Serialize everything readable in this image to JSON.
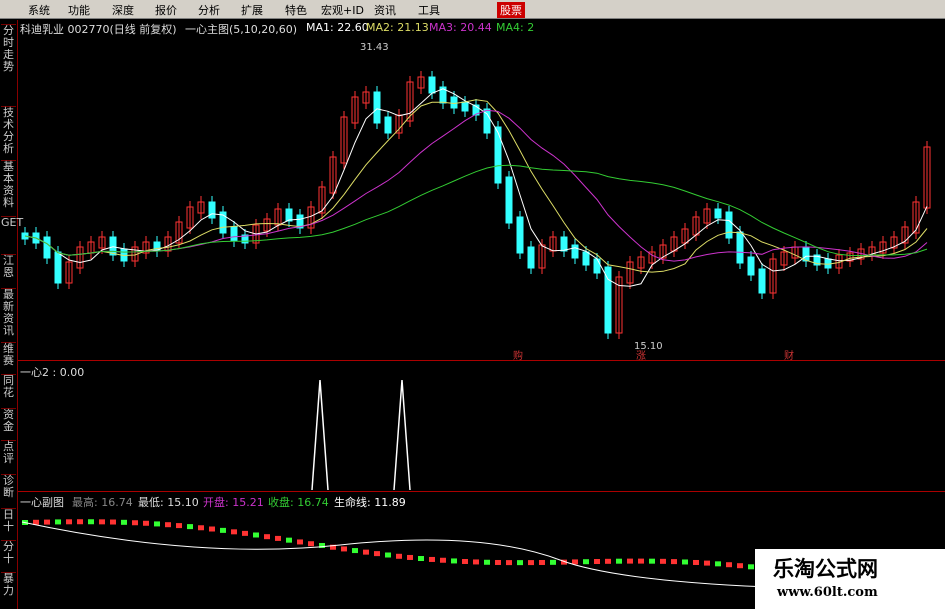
{
  "menu": [
    "系统",
    "功能",
    "深度",
    "报价",
    "分析",
    "扩展",
    "特色",
    "宏观+ID",
    "资讯",
    "工具"
  ],
  "menu_highlight": "股票",
  "sidebar": [
    "分时走势",
    "技术分析",
    "基本资料",
    "GET",
    "江恩",
    "最新资讯",
    "维赛",
    "同花",
    "资金",
    "点评",
    "诊断",
    "日十",
    "分十",
    "暴力"
  ],
  "main": {
    "stock": "科迪乳业 002770(日线 前复权)",
    "indicator": "一心主图(5,10,20,60)",
    "ma1": "MA1: 22.60",
    "ma2": "MA2: 21.13",
    "ma3": "MA3: 20.44",
    "ma4": "MA4: 2",
    "high_label": "31.43",
    "low_label": "15.10",
    "markers": [
      "购",
      "涨",
      "财"
    ]
  },
  "sub1": {
    "title": "一心2 : 0.00"
  },
  "sub2": {
    "title": "一心副图",
    "high": "最高: 16.74",
    "low": "最低: 15.10",
    "open": "开盘: 15.21",
    "close": "收盘: 16.74",
    "life": "生命线: 11.89"
  },
  "watermark": {
    "title": "乐淘公式网",
    "url": "www.60lt.com"
  },
  "colors": {
    "up": "#ff3333",
    "down": "#33ffff",
    "ma1": "#ffffff",
    "ma2": "#dddd66",
    "ma3": "#cc33cc",
    "ma4": "#33cc33",
    "bg": "#000000"
  }
}
